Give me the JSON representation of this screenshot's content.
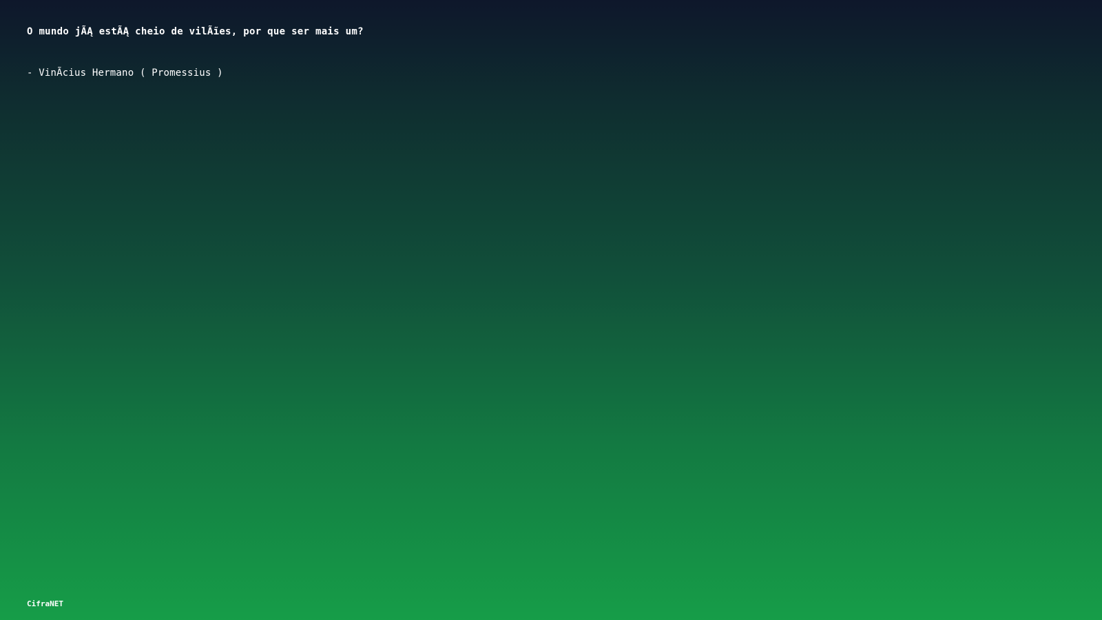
{
  "quote": {
    "text": "O mundo jÃĄ estÃĄ cheio de vilÃĩes, por que ser mais um?"
  },
  "author": {
    "text": "- VinÃ­cius Hermano ( Promessius )"
  },
  "footer": {
    "brand": "CifraNET"
  },
  "colors": {
    "gradient_top": "#0e172b",
    "gradient_bottom": "#169d48",
    "text": "#ffffff"
  }
}
